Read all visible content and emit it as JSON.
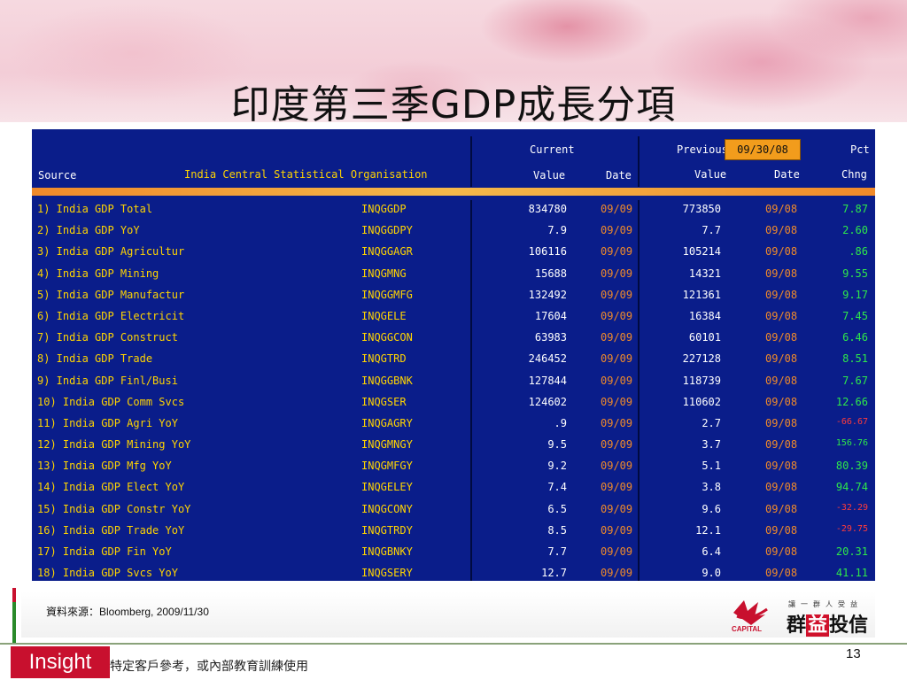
{
  "slide": {
    "title": "印度第三季GDP成長分項",
    "source_note": "資料來源：Bloomberg, 2009/11/30",
    "insight_label": "Insight",
    "disclaimer": "特定客戶參考，或內部教育訓練使用",
    "page_number": "13",
    "logo_text_1": "群",
    "logo_text_2": "益",
    "logo_text_3": "投信",
    "logo_slogan": "讓一群人受益",
    "logo_capital": "CAPITAL"
  },
  "terminal": {
    "source_label": "Source",
    "source_value": "India Central Statistical Organisation",
    "current_label": "Current",
    "value_label": "Value",
    "date_label": "Date",
    "previous_label": "Previous",
    "previous_date": "09/30/08",
    "pct_label": "Pct",
    "chng_label": "Chng",
    "colors": {
      "background": "#0a1d8a",
      "accent": "#ffd400",
      "orange": "#f08a2a",
      "positive": "#2ee84a",
      "negative": "#ff3b3b"
    },
    "rows": [
      {
        "name": "1) India GDP Total",
        "ticker": "INQGGDP",
        "value": "834780",
        "date": "09/09",
        "prev": "773850",
        "pdate": "09/08",
        "chng": "7.87",
        "sign": "pos"
      },
      {
        "name": "2) India GDP YoY",
        "ticker": "INQGGDPY",
        "value": "7.9",
        "date": "09/09",
        "prev": "7.7",
        "pdate": "09/08",
        "chng": "2.60",
        "sign": "pos"
      },
      {
        "name": "3) India GDP Agricultur",
        "ticker": "INQGGAGR",
        "value": "106116",
        "date": "09/09",
        "prev": "105214",
        "pdate": "09/08",
        "chng": ".86",
        "sign": "pos"
      },
      {
        "name": "4) India GDP Mining",
        "ticker": "INQGMNG",
        "value": "15688",
        "date": "09/09",
        "prev": "14321",
        "pdate": "09/08",
        "chng": "9.55",
        "sign": "pos"
      },
      {
        "name": "5) India GDP Manufactur",
        "ticker": "INQGGMFG",
        "value": "132492",
        "date": "09/09",
        "prev": "121361",
        "pdate": "09/08",
        "chng": "9.17",
        "sign": "pos"
      },
      {
        "name": "6) India GDP Electricit",
        "ticker": "INQGELE",
        "value": "17604",
        "date": "09/09",
        "prev": "16384",
        "pdate": "09/08",
        "chng": "7.45",
        "sign": "pos"
      },
      {
        "name": "7) India GDP Construct",
        "ticker": "INQGGCON",
        "value": "63983",
        "date": "09/09",
        "prev": "60101",
        "pdate": "09/08",
        "chng": "6.46",
        "sign": "pos"
      },
      {
        "name": "8) India GDP Trade",
        "ticker": "INQGTRD",
        "value": "246452",
        "date": "09/09",
        "prev": "227128",
        "pdate": "09/08",
        "chng": "8.51",
        "sign": "pos"
      },
      {
        "name": "9) India GDP Finl/Busi",
        "ticker": "INQGGBNK",
        "value": "127844",
        "date": "09/09",
        "prev": "118739",
        "pdate": "09/08",
        "chng": "7.67",
        "sign": "pos"
      },
      {
        "name": "10) India GDP Comm Svcs",
        "ticker": "INQGSER",
        "value": "124602",
        "date": "09/09",
        "prev": "110602",
        "pdate": "09/08",
        "chng": "12.66",
        "sign": "pos"
      },
      {
        "name": "11) India GDP Agri YoY",
        "ticker": "INQGAGRY",
        "value": ".9",
        "date": "09/09",
        "prev": "2.7",
        "pdate": "09/08",
        "chng": "-66.67",
        "sign": "neg"
      },
      {
        "name": "12) India GDP Mining YoY",
        "ticker": "INQGMNGY",
        "value": "9.5",
        "date": "09/09",
        "prev": "3.7",
        "pdate": "09/08",
        "chng": "156.76",
        "sign": "pos-small"
      },
      {
        "name": "13) India GDP Mfg YoY",
        "ticker": "INQGMFGY",
        "value": "9.2",
        "date": "09/09",
        "prev": "5.1",
        "pdate": "09/08",
        "chng": "80.39",
        "sign": "pos"
      },
      {
        "name": "14) India GDP Elect YoY",
        "ticker": "INQGELEY",
        "value": "7.4",
        "date": "09/09",
        "prev": "3.8",
        "pdate": "09/08",
        "chng": "94.74",
        "sign": "pos"
      },
      {
        "name": "15) India GDP Constr YoY",
        "ticker": "INQGCONY",
        "value": "6.5",
        "date": "09/09",
        "prev": "9.6",
        "pdate": "09/08",
        "chng": "-32.29",
        "sign": "neg"
      },
      {
        "name": "16) India GDP Trade YoY",
        "ticker": "INQGTRDY",
        "value": "8.5",
        "date": "09/09",
        "prev": "12.1",
        "pdate": "09/08",
        "chng": "-29.75",
        "sign": "neg"
      },
      {
        "name": "17) India GDP Fin YoY",
        "ticker": "INQGBNKY",
        "value": "7.7",
        "date": "09/09",
        "prev": "6.4",
        "pdate": "09/08",
        "chng": "20.31",
        "sign": "pos"
      },
      {
        "name": "18) India GDP Svcs YoY",
        "ticker": "INQGSERY",
        "value": "12.7",
        "date": "09/09",
        "prev": "9.0",
        "pdate": "09/08",
        "chng": "41.11",
        "sign": "pos"
      }
    ]
  }
}
